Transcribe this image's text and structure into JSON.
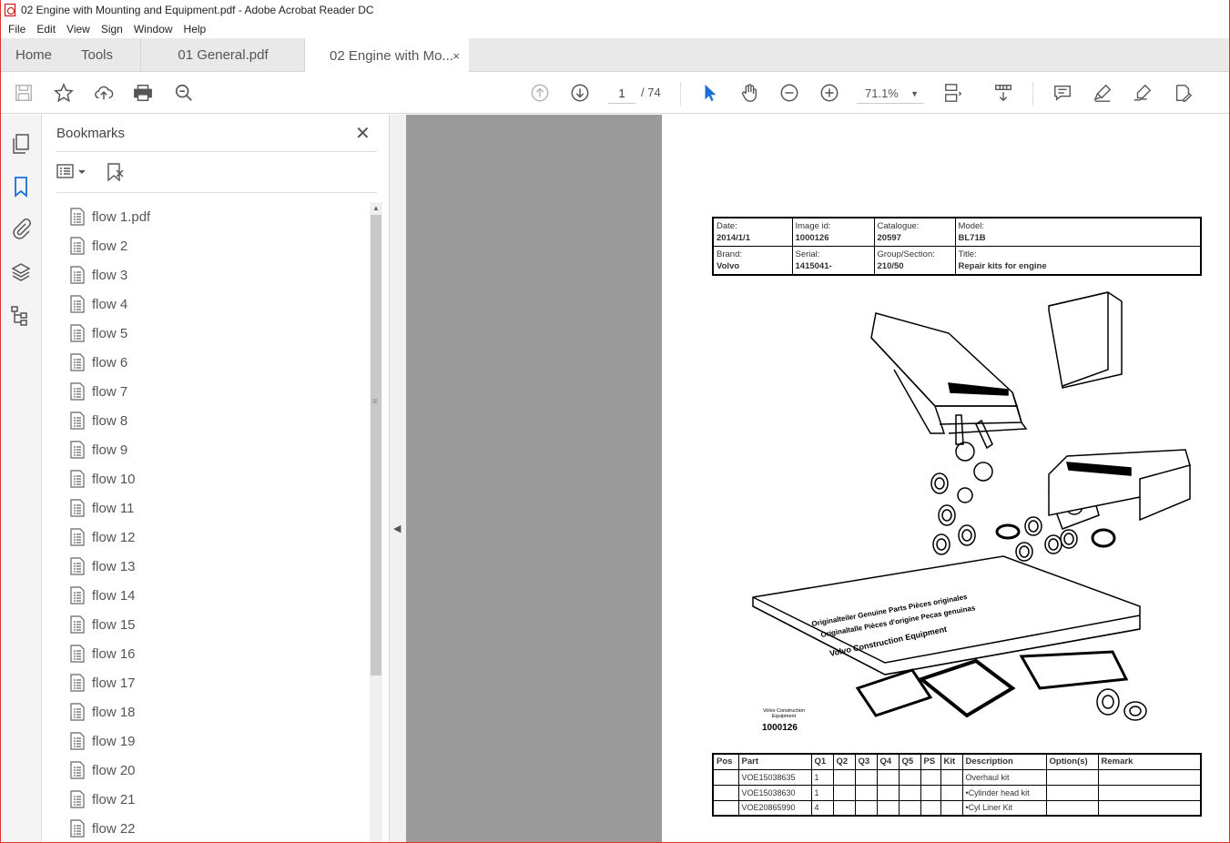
{
  "window": {
    "title": "02 Engine with Mounting and Equipment.pdf - Adobe Acrobat Reader DC"
  },
  "menu": [
    "File",
    "Edit",
    "View",
    "Sign",
    "Window",
    "Help"
  ],
  "tabs": {
    "home": "Home",
    "tools": "Tools",
    "doc1": "01 General.pdf",
    "doc2": "02 Engine with Mo...",
    "close": "×"
  },
  "toolbar": {
    "page_current": "1",
    "page_total": "/ 74",
    "zoom": "71.1%"
  },
  "bookmarks": {
    "title": "Bookmarks",
    "close": "✕",
    "items": [
      "flow 1.pdf",
      "flow 2",
      "flow 3",
      "flow 4",
      "flow 5",
      "flow 6",
      "flow 7",
      "flow 8",
      "flow 9",
      "flow 10",
      "flow 11",
      "flow 12",
      "flow 13",
      "flow 14",
      "flow 15",
      "flow 16",
      "flow 17",
      "flow 18",
      "flow 19",
      "flow 20",
      "flow 21",
      "flow 22"
    ]
  },
  "doc": {
    "header": {
      "date_label": "Date:",
      "date": "2014/1/1",
      "image_label": "Image id:",
      "image": "1000126",
      "catalogue_label": "Catalogue:",
      "catalogue": "20597",
      "model_label": "Model:",
      "model": "BL71B",
      "brand_label": "Brand:",
      "brand": "Volvo",
      "serial_label": "Serial:",
      "serial": "1415041-",
      "group_label": "Group/Section:",
      "group": "210/50",
      "title_label": "Title:",
      "title": "Repair kits for engine"
    },
    "image_caption_line1": "Volvo Construction",
    "image_caption_line2": "Equipment",
    "image_id": "1000126",
    "box_text_1": "Originalteiler Genuine Parts Pièces originales",
    "box_text_2": "Originaltalle Pièces d'origine Pecas genuinas",
    "box_text_3": "Volvo Construction Equipment",
    "parts_columns": [
      "Pos",
      "Part",
      "Q1",
      "Q2",
      "Q3",
      "Q4",
      "Q5",
      "PS",
      "Kit",
      "Description",
      "Option(s)",
      "Remark"
    ],
    "parts_rows": [
      {
        "part": "VOE15038635",
        "q1": "1",
        "desc": "Overhaul kit"
      },
      {
        "part": "VOE15038630",
        "q1": "1",
        "desc": "•Cylinder head kit"
      },
      {
        "part": "VOE20865990",
        "q1": "4",
        "desc": "•Cyl Liner Kit"
      }
    ]
  }
}
